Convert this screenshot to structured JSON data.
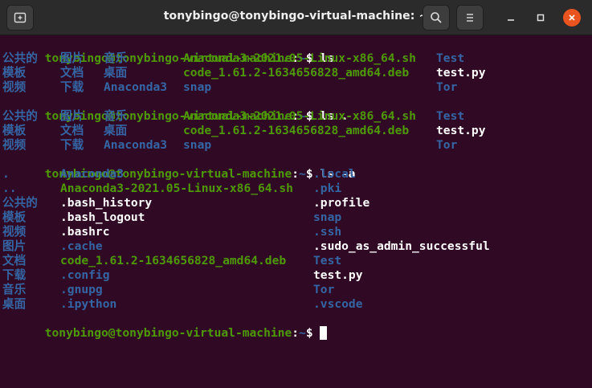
{
  "window": {
    "title": "tonybingo@tonybingo-virtual-machine: ~",
    "icons": [
      "new-tab-icon",
      "search-icon",
      "menu-icon",
      "minimize-icon",
      "maximize-icon",
      "close-icon"
    ]
  },
  "colors": {
    "background": "#300a24",
    "prompt": "#4e9a06",
    "directory": "#3465a4",
    "executable": "#4e9a06",
    "text": "#ffffff",
    "close": "#e95420"
  },
  "terminal": {
    "prompt_user": "tonybingo@tonybingo-virtual-machine",
    "prompt_sep": ":",
    "prompt_path": "~",
    "prompt_end": "$",
    "cmd1": "ls",
    "cmd2": "ls .",
    "cmd3": "ls -a",
    "ls": {
      "r1": [
        "公共的",
        "图片",
        "音乐",
        "Anaconda3-2021.05-Linux-x86_64.sh",
        "Test"
      ],
      "r2": [
        "模板",
        "文档",
        "桌面",
        "code_1.61.2-1634656828_amd64.deb",
        "test.py"
      ],
      "r3": [
        "视频",
        "下载",
        "Anaconda3",
        "snap",
        "Tor"
      ]
    },
    "lsa": {
      "col1": [
        ".",
        "..",
        "公共的",
        "模板",
        "视频",
        "图片",
        "文档",
        "下载",
        "音乐",
        "桌面"
      ],
      "col2": [
        "Anaconda3",
        "Anaconda3-2021.05-Linux-x86_64.sh",
        ".bash_history",
        ".bash_logout",
        ".bashrc",
        ".cache",
        "code_1.61.2-1634656828_amd64.deb",
        ".config",
        ".gnupg",
        ".ipython"
      ],
      "col3": [
        ".local",
        ".pki",
        ".profile",
        "snap",
        ".ssh",
        ".sudo_as_admin_successful",
        "Test",
        "test.py",
        "Tor",
        ".vscode"
      ]
    }
  }
}
